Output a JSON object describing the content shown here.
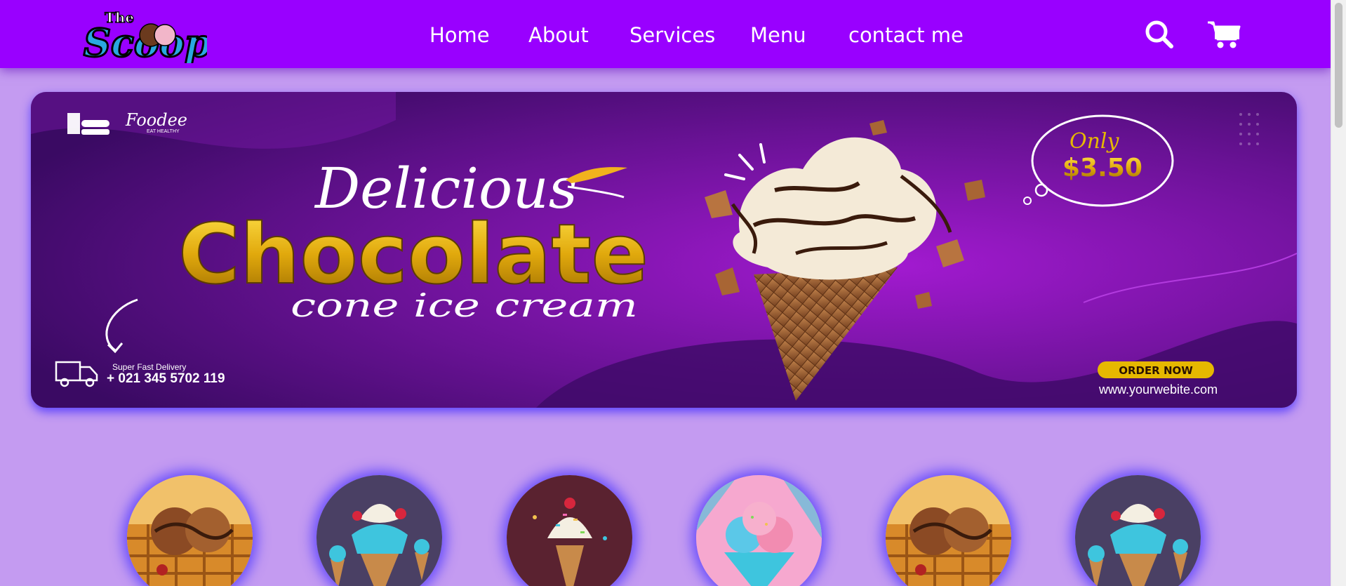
{
  "header": {
    "logo": {
      "text_top": "The",
      "text_main": "Scoop"
    },
    "nav": [
      {
        "label": "Home"
      },
      {
        "label": "About"
      },
      {
        "label": "Services"
      },
      {
        "label": "Menu"
      },
      {
        "label": "contact me"
      }
    ],
    "icons": {
      "search": "search-icon",
      "cart": "shopping-cart-icon"
    }
  },
  "banner": {
    "brand": "Foodee",
    "brand_tagline": "EAT HEALTHY",
    "headline_script": "Delicious",
    "headline_main": "Chocolate",
    "headline_sub": "cone ice cream",
    "price_prefix": "Only",
    "price": "$3.50",
    "delivery_label": "Super Fast Delivery",
    "phone": "+ 021 345 5702 119",
    "cta": "ORDER NOW",
    "website": "www.yourwebite.com"
  },
  "thumbnails": [
    {
      "name": "waffle-ice-cream"
    },
    {
      "name": "blue-cone-sundae"
    },
    {
      "name": "sprinkle-cone"
    },
    {
      "name": "pink-blue-cup"
    },
    {
      "name": "waffle-ice-cream-2"
    },
    {
      "name": "blue-cone-sundae-2"
    }
  ],
  "colors": {
    "header_bg": "#9900ff",
    "page_bg": "#c49bf1",
    "banner_bg": "#5a0f86",
    "accent_gold": "#e6b800"
  }
}
